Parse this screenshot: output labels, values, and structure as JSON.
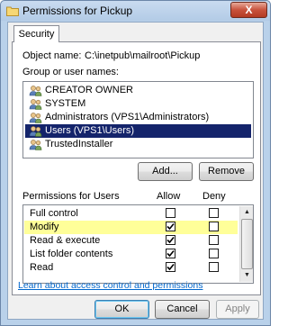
{
  "window": {
    "title": "Permissions for Pickup",
    "close_label": "X"
  },
  "tabs": [
    {
      "label": "Security"
    }
  ],
  "object": {
    "label": "Object name:",
    "value": "C:\\inetpub\\mailroot\\Pickup"
  },
  "group": {
    "label": "Group or user names:",
    "items": [
      {
        "label": "CREATOR OWNER",
        "icon": "user-group-icon",
        "selected": false
      },
      {
        "label": "SYSTEM",
        "icon": "user-group-icon",
        "selected": false
      },
      {
        "label": "Administrators (VPS1\\Administrators)",
        "icon": "user-group-icon",
        "selected": false
      },
      {
        "label": "Users (VPS1\\Users)",
        "icon": "user-group-icon",
        "selected": true
      },
      {
        "label": "TrustedInstaller",
        "icon": "user-group-icon",
        "selected": false
      }
    ]
  },
  "buttons": {
    "add": "Add...",
    "remove": "Remove"
  },
  "permissions": {
    "title": "Permissions for Users",
    "allow_label": "Allow",
    "deny_label": "Deny",
    "rows": [
      {
        "name": "Full control",
        "allow": false,
        "deny": false,
        "highlight": false
      },
      {
        "name": "Modify",
        "allow": true,
        "deny": false,
        "highlight": true
      },
      {
        "name": "Read & execute",
        "allow": true,
        "deny": false,
        "highlight": false
      },
      {
        "name": "List folder contents",
        "allow": true,
        "deny": false,
        "highlight": false
      },
      {
        "name": "Read",
        "allow": true,
        "deny": false,
        "highlight": false
      }
    ]
  },
  "link": "Learn about access control and permissions",
  "footer": {
    "ok": "OK",
    "cancel": "Cancel",
    "apply": "Apply"
  },
  "colors": {
    "selection": "#14246b",
    "highlight": "#ffff99",
    "link": "#0066cc"
  }
}
